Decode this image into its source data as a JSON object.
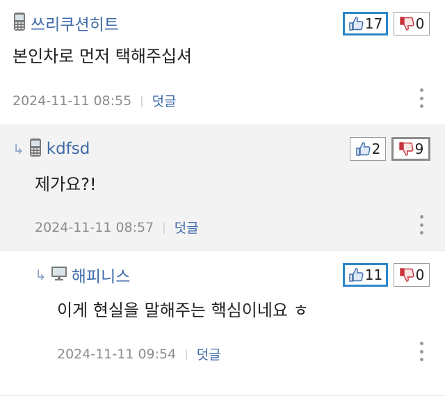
{
  "comments": [
    {
      "author": "쓰리쿠션히트",
      "device_icon": "mobile-phone-icon",
      "body": "본인차로 먼저 택해주십셔",
      "timestamp": "2024-11-11 08:55",
      "reply_label": "덧글",
      "upvotes": "17",
      "downvotes": "0",
      "active_vote": "up"
    },
    {
      "author": "kdfsd",
      "device_icon": "mobile-phone-icon",
      "body": "제가요?!",
      "timestamp": "2024-11-11 08:57",
      "reply_label": "덧글",
      "upvotes": "2",
      "downvotes": "9",
      "active_vote": "down"
    },
    {
      "author": "해피니스",
      "device_icon": "desktop-computer-icon",
      "body": "이게 현실을 말해주는 핵심이네요 ㅎ",
      "timestamp": "2024-11-11 09:54",
      "reply_label": "덧글",
      "upvotes": "11",
      "downvotes": "0",
      "active_vote": "up"
    }
  ],
  "separator": "|",
  "reply_arrow": "↳",
  "colors": {
    "author": "#3d6aa8",
    "up_active_border": "#2c86c8",
    "down_active_border": "#8a8a8a",
    "reply_bg": "#f3f3f3",
    "thumb_down_red": "#c8323a"
  }
}
